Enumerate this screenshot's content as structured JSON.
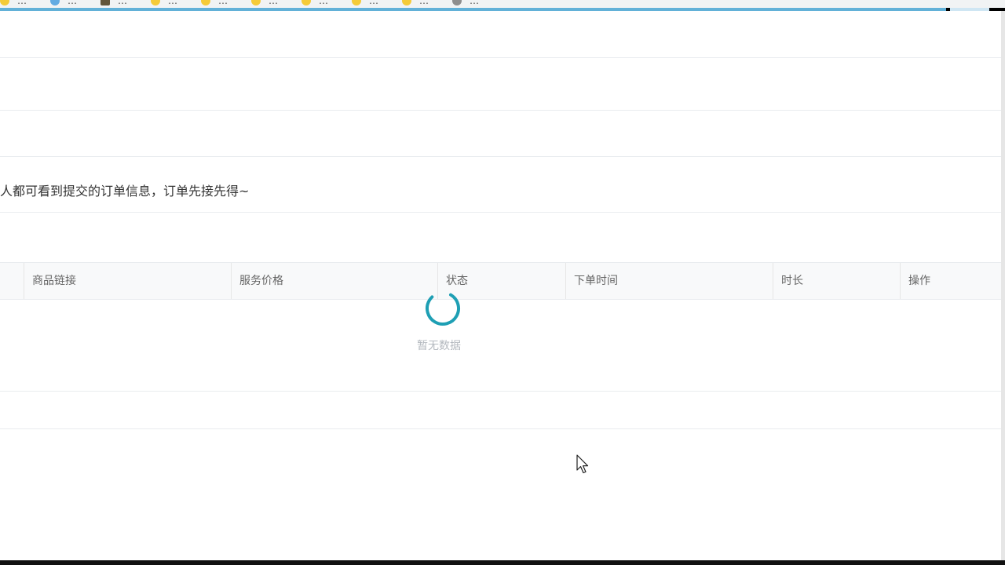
{
  "browser": {
    "bookmarks": [
      {
        "label": "…",
        "icon": "yellow-bookmark-icon"
      },
      {
        "label": "…",
        "icon": "blue-globe-icon"
      },
      {
        "label": "…",
        "icon": "game-icon"
      },
      {
        "label": "…",
        "icon": "yellow-bookmark-icon"
      },
      {
        "label": "…",
        "icon": "yellow-bookmark-icon"
      },
      {
        "label": "…",
        "icon": "yellow-bookmark-icon"
      },
      {
        "label": "…",
        "icon": "yellow-bookmark-icon"
      },
      {
        "label": "…",
        "icon": "yellow-bookmark-icon"
      },
      {
        "label": "…",
        "icon": "yellow-bookmark-icon"
      },
      {
        "label": "…",
        "icon": "gray-globe-icon"
      }
    ],
    "accent": "#62b1d8"
  },
  "notice": {
    "text": "人都可看到提交的订单信息，订单先接先得~"
  },
  "table": {
    "columns": [
      "",
      "商品链接",
      "服务价格",
      "状态",
      "下单时间",
      "时长",
      "操作"
    ],
    "empty_text": "暂无数据",
    "spinner_color": "#1e9fb4"
  }
}
